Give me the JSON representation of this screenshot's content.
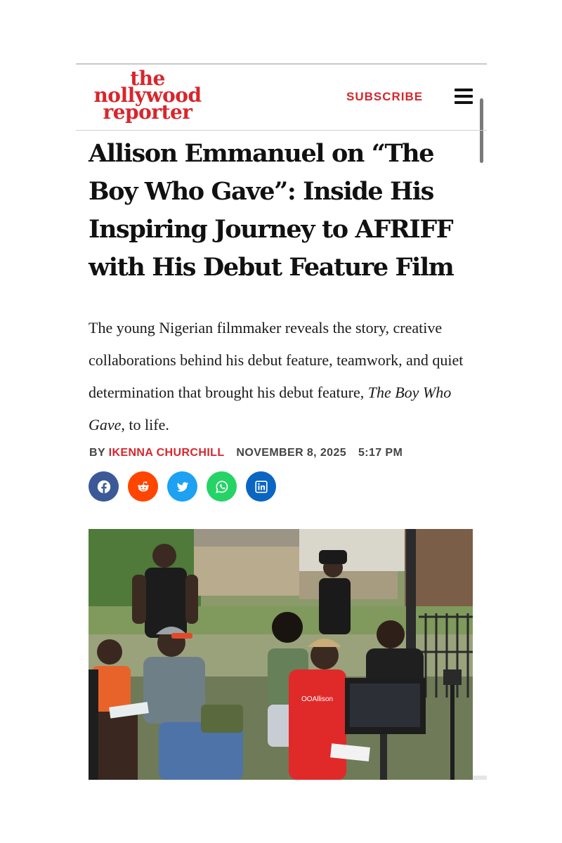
{
  "header": {
    "logo": {
      "line1": "the",
      "line2": "nollywood",
      "line3": "reporter"
    },
    "subscribe_label": "SUBSCRIBE",
    "menu_icon": "hamburger-menu-icon"
  },
  "article": {
    "headline": "Allison Emmanuel on “The Boy Who Gave”: Inside His Inspiring Journey to AFRIFF with His Debut Feature Film",
    "dek_before": "The young Nigerian filmmaker reveals the story, creative collaborations behind his debut feature, teamwork, and quiet determination that brought his debut feature, ",
    "dek_italic": "The Boy Who Gave",
    "dek_after": ", to life.",
    "byline_prefix": "BY",
    "author": "IKENNA CHURCHILL",
    "date": "NOVEMBER 8, 2025",
    "time": "5:17 PM"
  },
  "share": [
    {
      "name": "facebook-share-button",
      "icon": "facebook-icon",
      "color": "#3b5998"
    },
    {
      "name": "reddit-share-button",
      "icon": "reddit-icon",
      "color": "#ff4500"
    },
    {
      "name": "twitter-share-button",
      "icon": "twitter-icon",
      "color": "#1da1f2"
    },
    {
      "name": "whatsapp-share-button",
      "icon": "whatsapp-icon",
      "color": "#25d366"
    },
    {
      "name": "linkedin-share-button",
      "icon": "linkedin-icon",
      "color": "#0a66c2"
    }
  ],
  "photo": {
    "shirt_text": "OOАllison"
  },
  "colors": {
    "brand_red": "#d7262c",
    "text": "#111111"
  }
}
